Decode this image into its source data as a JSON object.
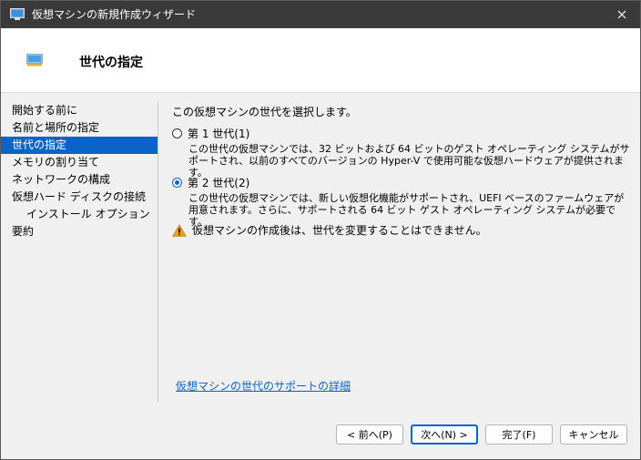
{
  "window": {
    "title": "仮想マシンの新規作成ウィザード"
  },
  "header": {
    "title": "世代の指定"
  },
  "nav": {
    "items": [
      {
        "label": "開始する前に",
        "selected": false,
        "sub": false
      },
      {
        "label": "名前と場所の指定",
        "selected": false,
        "sub": false
      },
      {
        "label": "世代の指定",
        "selected": true,
        "sub": false
      },
      {
        "label": "メモリの割り当て",
        "selected": false,
        "sub": false
      },
      {
        "label": "ネットワークの構成",
        "selected": false,
        "sub": false
      },
      {
        "label": "仮想ハード ディスクの接続",
        "selected": false,
        "sub": false
      },
      {
        "label": "インストール オプション",
        "selected": false,
        "sub": true
      },
      {
        "label": "要約",
        "selected": false,
        "sub": false
      }
    ]
  },
  "content": {
    "intro": "この仮想マシンの世代を選択します。",
    "gen1": {
      "label": "第 1 世代(1)",
      "checked": false,
      "description": "この世代の仮想マシンでは、32 ビットおよび 64 ビットのゲスト オペレーティング システムがサポートされ、以前のすべてのバージョンの Hyper-V で使用可能な仮想ハードウェアが提供されます。"
    },
    "gen2": {
      "label": "第 2 世代(2)",
      "checked": true,
      "description": "この世代の仮想マシンでは、新しい仮想化機能がサポートされ、UEFI ベースのファームウェアが用意されます。さらに、サポートされる 64 ビット ゲスト オペレーティング システムが必要です。"
    },
    "warning": "仮想マシンの作成後は、世代を変更することはできません。",
    "help_link": "仮想マシンの世代のサポートの詳細"
  },
  "footer": {
    "prev": "< 前へ(P)",
    "next": "次へ(N) >",
    "finish": "完了(F)",
    "cancel": "キャンセル"
  },
  "colors": {
    "accent": "#0a64c8",
    "titlebar": "#3a3a3a",
    "warning": "#e8a317"
  }
}
